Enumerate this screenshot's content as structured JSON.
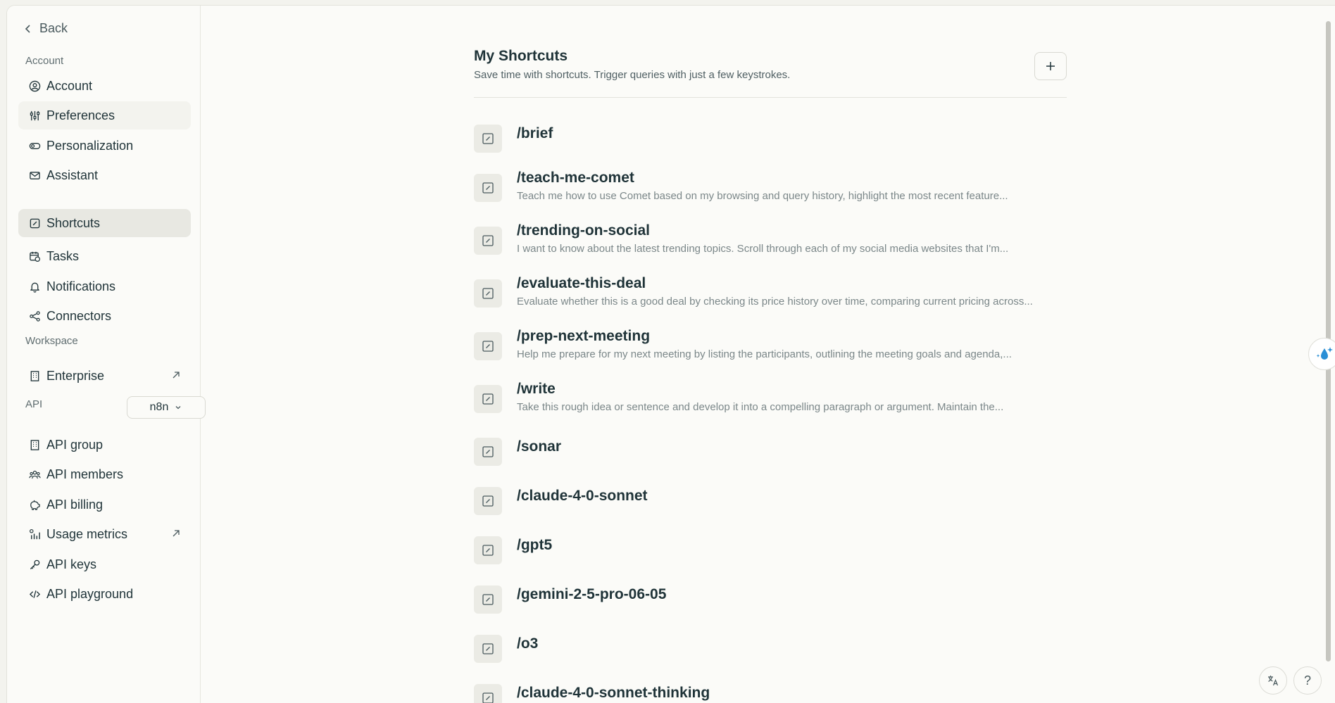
{
  "sidebar": {
    "back_label": "Back",
    "account_section": "Account",
    "account_items": [
      {
        "label": "Account",
        "icon": "user-circle-icon"
      },
      {
        "label": "Preferences",
        "icon": "sliders-icon"
      },
      {
        "label": "Personalization",
        "icon": "toggle-icon"
      },
      {
        "label": "Assistant",
        "icon": "mail-icon"
      },
      {
        "label": "Shortcuts",
        "icon": "shortcut-icon"
      },
      {
        "label": "Tasks",
        "icon": "calendar-clock-icon"
      },
      {
        "label": "Notifications",
        "icon": "bell-icon"
      },
      {
        "label": "Connectors",
        "icon": "share-nodes-icon"
      }
    ],
    "workspace_section": "Workspace",
    "workspace_items": [
      {
        "label": "Enterprise",
        "icon": "building-icon"
      }
    ],
    "api_section": "API",
    "api_select_value": "n8n",
    "api_items": [
      {
        "label": "API group",
        "icon": "building-icon"
      },
      {
        "label": "API members",
        "icon": "users-icon"
      },
      {
        "label": "API billing",
        "icon": "piggy-bank-icon"
      },
      {
        "label": "Usage metrics",
        "icon": "bar-chart-icon"
      },
      {
        "label": "API keys",
        "icon": "key-icon"
      },
      {
        "label": "API playground",
        "icon": "code-icon"
      }
    ]
  },
  "main": {
    "title": "My Shortcuts",
    "subtitle": "Save time with shortcuts. Trigger queries with just a few keystrokes.",
    "add_label": "+",
    "shortcuts": [
      {
        "name": "/brief",
        "desc": ""
      },
      {
        "name": "/teach-me-comet",
        "desc": "Teach me how to use Comet based on my browsing and query history, highlight the most recent feature..."
      },
      {
        "name": "/trending-on-social",
        "desc": "I want to know about the latest trending topics. Scroll through each of my social media websites that I'm..."
      },
      {
        "name": "/evaluate-this-deal",
        "desc": "Evaluate whether this is a good deal by checking its price history over time, comparing current pricing across..."
      },
      {
        "name": "/prep-next-meeting",
        "desc": "Help me prepare for my next meeting by listing the participants, outlining the meeting goals and agenda,..."
      },
      {
        "name": "/write",
        "desc": "Take this rough idea or sentence and develop it into a compelling paragraph or argument. Maintain the..."
      },
      {
        "name": "/sonar",
        "desc": ""
      },
      {
        "name": "/claude-4-0-sonnet",
        "desc": ""
      },
      {
        "name": "/gpt5",
        "desc": ""
      },
      {
        "name": "/gemini-2-5-pro-06-05",
        "desc": ""
      },
      {
        "name": "/o3",
        "desc": ""
      },
      {
        "name": "/claude-4-0-sonnet-thinking",
        "desc": ""
      }
    ]
  },
  "footer": {
    "translate_icon": "translate-icon",
    "help_label": "?"
  },
  "colors": {
    "background": "#fbfbf8",
    "text": "#1f3338",
    "active_nav": "#e8e8e2",
    "accent_blue": "#2a8fd6"
  }
}
